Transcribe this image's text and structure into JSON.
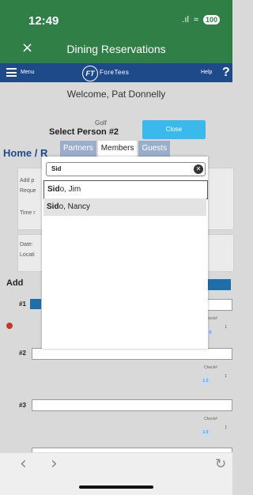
{
  "status_bar": {
    "time": "12:49",
    "signal": ".ıl",
    "wifi": "≈",
    "battery": "100"
  },
  "nav": {
    "close_glyph": "×",
    "title": "Dining Reservations"
  },
  "app_header": {
    "menu_label": "Menu",
    "logo_mark": "FT",
    "logo_text": "ForeTees",
    "help_label": "Help",
    "help_glyph": "?"
  },
  "page": {
    "welcome": "Welcome, Pat Donnelly",
    "golf_label": "Golf",
    "select_person": "Select Person #2",
    "close_label": "Close",
    "home_text": "Home / R",
    "add_text_1": "Add p",
    "request_text": "Reque",
    "time_text": "Time r",
    "date_text": "Date:",
    "location_text": "Locati",
    "add_heading": "Add",
    "row1": "#1",
    "row2": "#2",
    "row3": "#3",
    "check_label": "Check#",
    "check_value": "1 0",
    "updown": "↕"
  },
  "modal": {
    "tabs": [
      "Partners",
      "Members",
      "Guests"
    ],
    "active_tab": "Members",
    "search_value": "Sid",
    "clear_glyph": "✕",
    "results": [
      {
        "match": "Sid",
        "rest": "o, Jim"
      },
      {
        "match": "Sid",
        "rest": "o, Nancy"
      }
    ]
  },
  "browser_bar": {
    "back": "‹",
    "forward": "›",
    "reload": "↻"
  }
}
